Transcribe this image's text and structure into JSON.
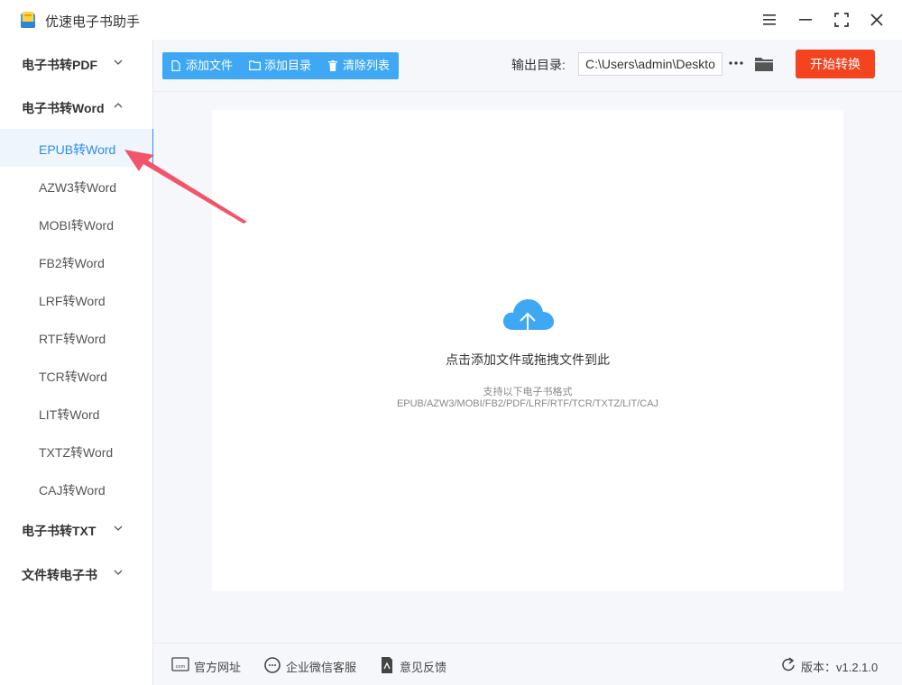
{
  "window": {
    "title": "优速电子书助手",
    "buttons": [
      "menu-icon",
      "minimize-icon",
      "maximize-icon",
      "close-icon"
    ]
  },
  "sidebar": {
    "groups": [
      {
        "label": "电子书转PDF",
        "expanded": false
      },
      {
        "label": "电子书转Word",
        "expanded": true
      },
      {
        "label": "电子书转TXT",
        "expanded": false
      },
      {
        "label": "文件转电子书",
        "expanded": false
      }
    ],
    "word_items": [
      {
        "label": "EPUB转Word",
        "active": true
      },
      {
        "label": "AZW3转Word",
        "active": false
      },
      {
        "label": "MOBI转Word",
        "active": false
      },
      {
        "label": "FB2转Word",
        "active": false
      },
      {
        "label": "LRF转Word",
        "active": false
      },
      {
        "label": "RTF转Word",
        "active": false
      },
      {
        "label": "TCR转Word",
        "active": false
      },
      {
        "label": "LIT转Word",
        "active": false
      },
      {
        "label": "TXTZ转Word",
        "active": false
      },
      {
        "label": "CAJ转Word",
        "active": false
      }
    ]
  },
  "toolbar": {
    "add_file": "添加文件",
    "add_folder": "添加目录",
    "clear_list": "清除列表",
    "output_label": "输出目录:",
    "output_path": "C:\\Users\\admin\\Desktop",
    "start": "开始转换"
  },
  "drop_zone": {
    "hint": "点击添加文件或拖拽文件到此",
    "formats_title": "支持以下电子书格式",
    "formats": "EPUB/AZW3/MOBI/FB2/PDF/LRF/RTF/TCR/TXTZ/LIT/CAJ"
  },
  "footer": {
    "website": "官方网址",
    "wechat": "企业微信客服",
    "feedback": "意见反馈",
    "version": "版本：v1.2.1.0"
  },
  "colors": {
    "accent": "#2d8cf0",
    "toolbar": "#3fa8f5",
    "start_button": "#f3431f",
    "annotation_arrow": "#f2546a"
  }
}
